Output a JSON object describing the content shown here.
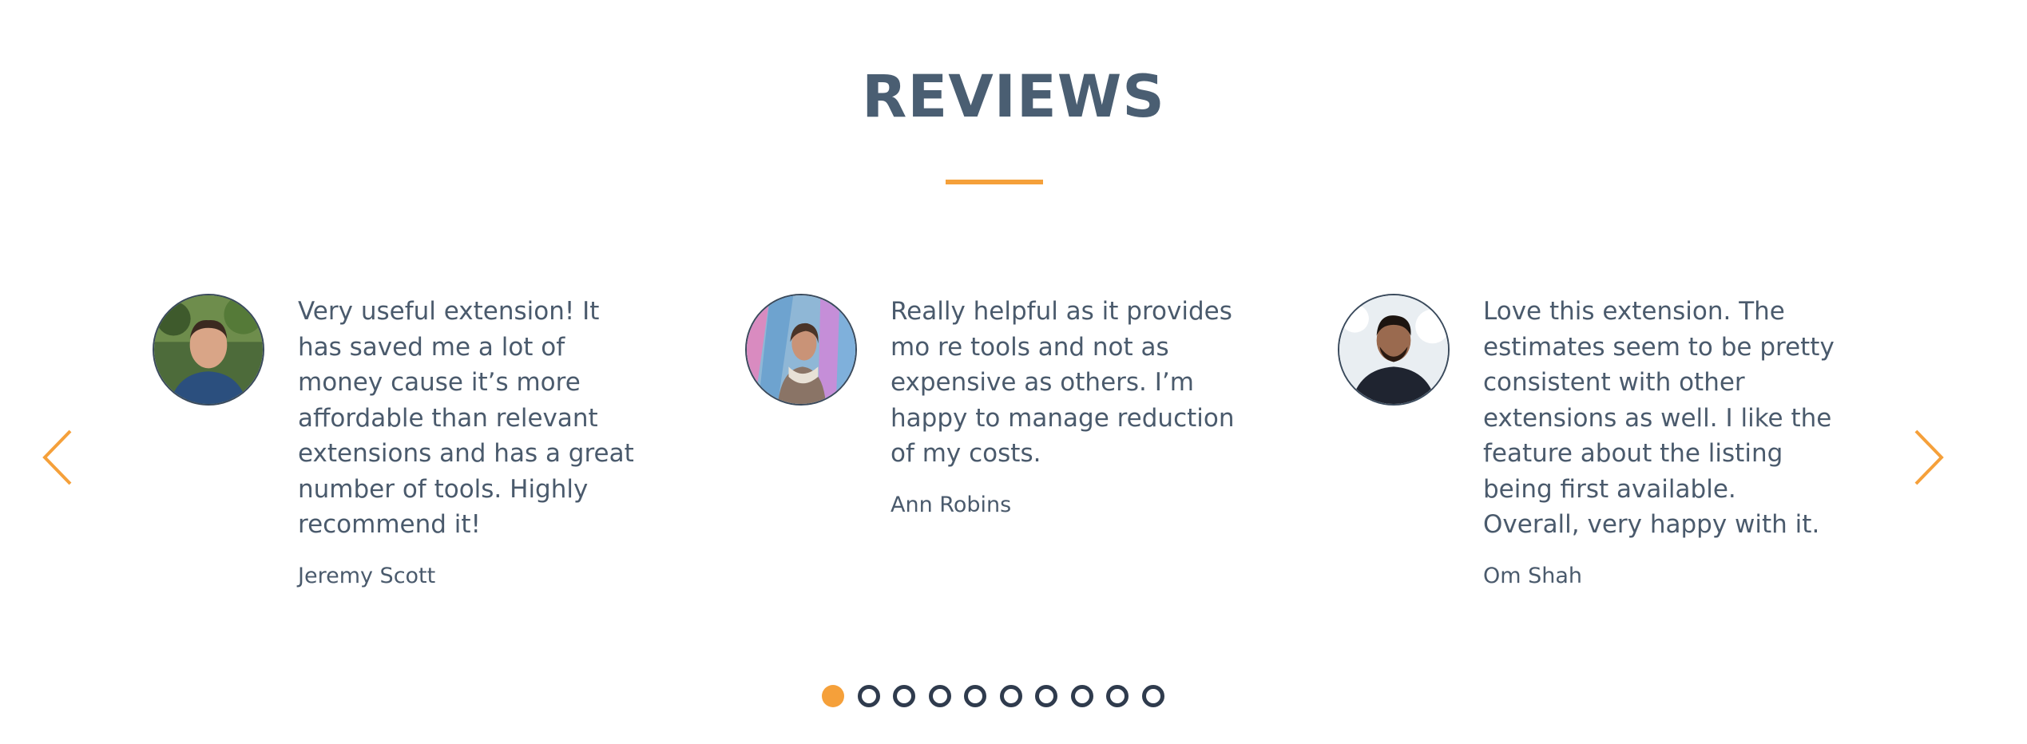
{
  "section": {
    "title": "REVIEWS"
  },
  "colors": {
    "accent": "#f5a03a",
    "text": "#4a5a6c",
    "dot_outline": "#2f3b4d"
  },
  "navigation": {
    "prev_icon": "chevron-left-icon",
    "next_icon": "chevron-right-icon"
  },
  "reviews": [
    {
      "text": "Very useful extension! It has saved me a lot of money cause it’s more affordable than relevant extensions and has a great number of tools. Highly recommend it!",
      "author": "Jeremy Scott"
    },
    {
      "text": "Really helpful as it provides mo re tools and not as expensive as others. I’m happy to manage reduction of my costs.",
      "author": "Ann Robins"
    },
    {
      "text": "Love this extension. The estimates seem to be pretty consistent with other extensions as well. I like the feature about the listing being first available. Overall, very happy with it.",
      "author": "Om Shah"
    }
  ],
  "pagination": {
    "total": 10,
    "active": 1
  }
}
